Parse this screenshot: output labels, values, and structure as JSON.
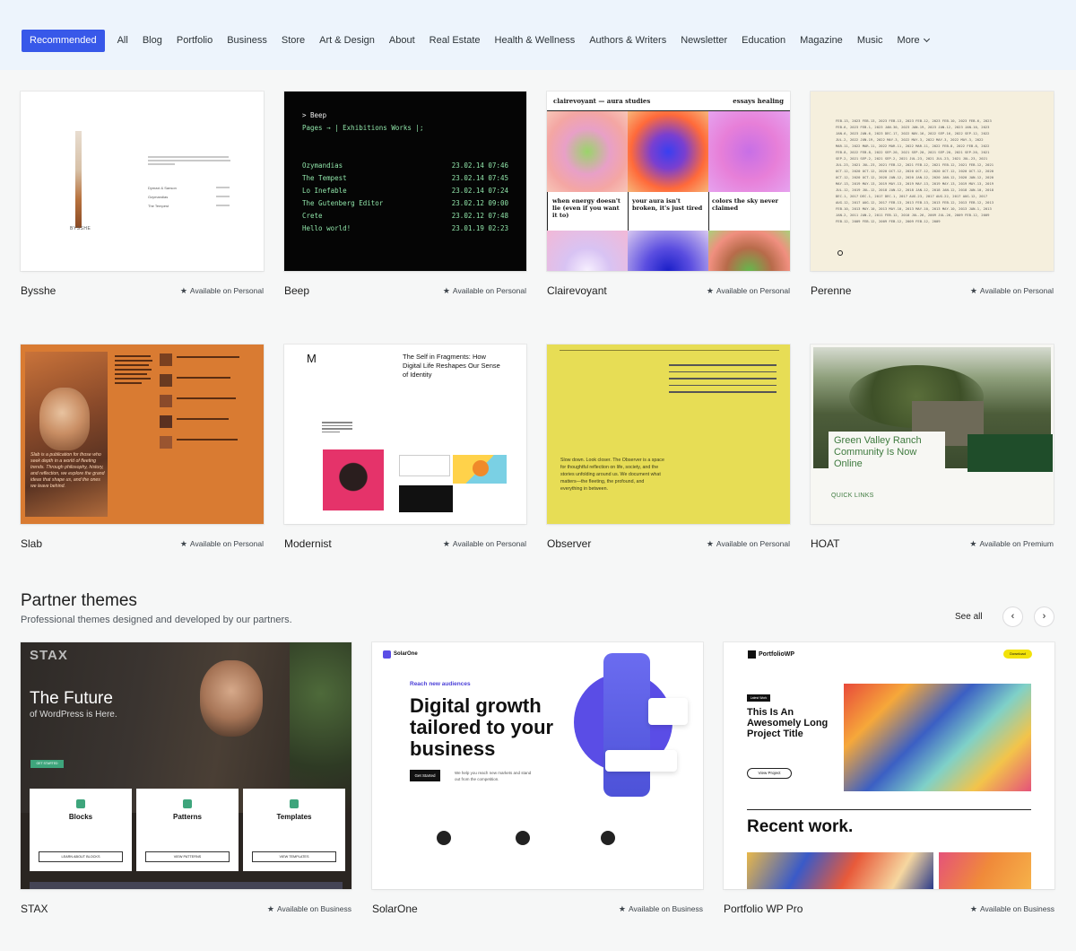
{
  "nav": {
    "items": [
      "Recommended",
      "All",
      "Blog",
      "Portfolio",
      "Business",
      "Store",
      "Art & Design",
      "About",
      "Real Estate",
      "Health & Wellness",
      "Authors & Writers",
      "Newsletter",
      "Education",
      "Magazine",
      "Music",
      "More"
    ],
    "active": "Recommended"
  },
  "themes": [
    {
      "name": "Bysshe",
      "availability": "Available on Personal"
    },
    {
      "name": "Beep",
      "availability": "Available on Personal"
    },
    {
      "name": "Clairevoyant",
      "availability": "Available on Personal"
    },
    {
      "name": "Perenne",
      "availability": "Available on Personal"
    },
    {
      "name": "Slab",
      "availability": "Available on Personal"
    },
    {
      "name": "Modernist",
      "availability": "Available on Personal"
    },
    {
      "name": "Observer",
      "availability": "Available on Personal"
    },
    {
      "name": "HOAT",
      "availability": "Available on Premium"
    }
  ],
  "previews": {
    "bysshe": {
      "caption": "BYSSHE",
      "links": [
        "Dymaxi & Sanson",
        "Ozymandias",
        "The Tempest"
      ]
    },
    "beep": {
      "prompt": "> Beep",
      "nav": "Pages → | Exhibitions  Works |;",
      "rows": [
        {
          "title": "Ozymandias",
          "date": "23.02.14 07:46"
        },
        {
          "title": "The Tempest",
          "date": "23.02.14 07:45"
        },
        {
          "title": "Lo Inefable",
          "date": "23.02.14 07:24"
        },
        {
          "title": "The Gutenberg Editor",
          "date": "23.02.12 09:00"
        },
        {
          "title": "Crete",
          "date": "23.02.12 07:48"
        },
        {
          "title": "Hello world!",
          "date": "23.01.19 02:23"
        }
      ]
    },
    "clairevoyant": {
      "brand": "clairevoyant — aura studies",
      "links": "essays   healing",
      "captions": [
        "when energy doesn't lie (even if you want it to)",
        "your aura isn't broken, it's just tired",
        "colors the sky never claimed"
      ]
    },
    "modernist": {
      "logo": "M",
      "headline": "The Self in Fragments: How Digital Life Reshapes Our Sense of Identity"
    },
    "hoat": {
      "headline": "Green Valley Ranch Community Is Now Online",
      "quick_links": "QUICK LINKS"
    },
    "slab": {
      "quote": "Slab is a publication for those who seek depth in a world of fleeting trends. Through philosophy, history, and reflection, we explore the grand ideas that shape us, and the ones we leave behind."
    },
    "observer": {
      "quote": "Slow down. Look closer. The Observer is a space for thoughtful reflection on life, society, and the stories unfolding around us. We document what matters—the fleeting, the profound, and everything in between."
    }
  },
  "partner": {
    "title": "Partner themes",
    "subtitle": "Professional themes designed and developed by our partners.",
    "see_all": "See all",
    "prev_icon": "‹",
    "next_icon": "›",
    "themes": [
      {
        "name": "STAX",
        "availability": "Available on Business"
      },
      {
        "name": "SolarOne",
        "availability": "Available on Business"
      },
      {
        "name": "Portfolio WP Pro",
        "availability": "Available on Business"
      }
    ]
  },
  "stax": {
    "logo": "STAX",
    "hero_line1": "The Future",
    "hero_line2": "of WordPress is Here.",
    "cta": "GET STARTED",
    "boxes": [
      {
        "title": "Blocks",
        "button": "LEARN ABOUT BLOCKS"
      },
      {
        "title": "Patterns",
        "button": "VIEW PATTERNS"
      },
      {
        "title": "Templates",
        "button": "VIEW TEMPLATES"
      }
    ]
  },
  "solarone": {
    "logo": "SolarOne",
    "eyebrow": "Reach new audiences",
    "headline": "Digital growth tailored to your business",
    "cta": "Get Started",
    "body": "We help you reach new markets and stand out from the competition."
  },
  "portfoliowp": {
    "logo": "PortfolioWP",
    "download": "Download",
    "badge": "Latest Work",
    "title": "This Is An Awesomely Long Project Title",
    "button": "View Project",
    "recent": "Recent work."
  },
  "colors": {
    "accent": "#3858e9",
    "nav_bg": "#edf4fc",
    "page_bg": "#f6f7f7"
  }
}
